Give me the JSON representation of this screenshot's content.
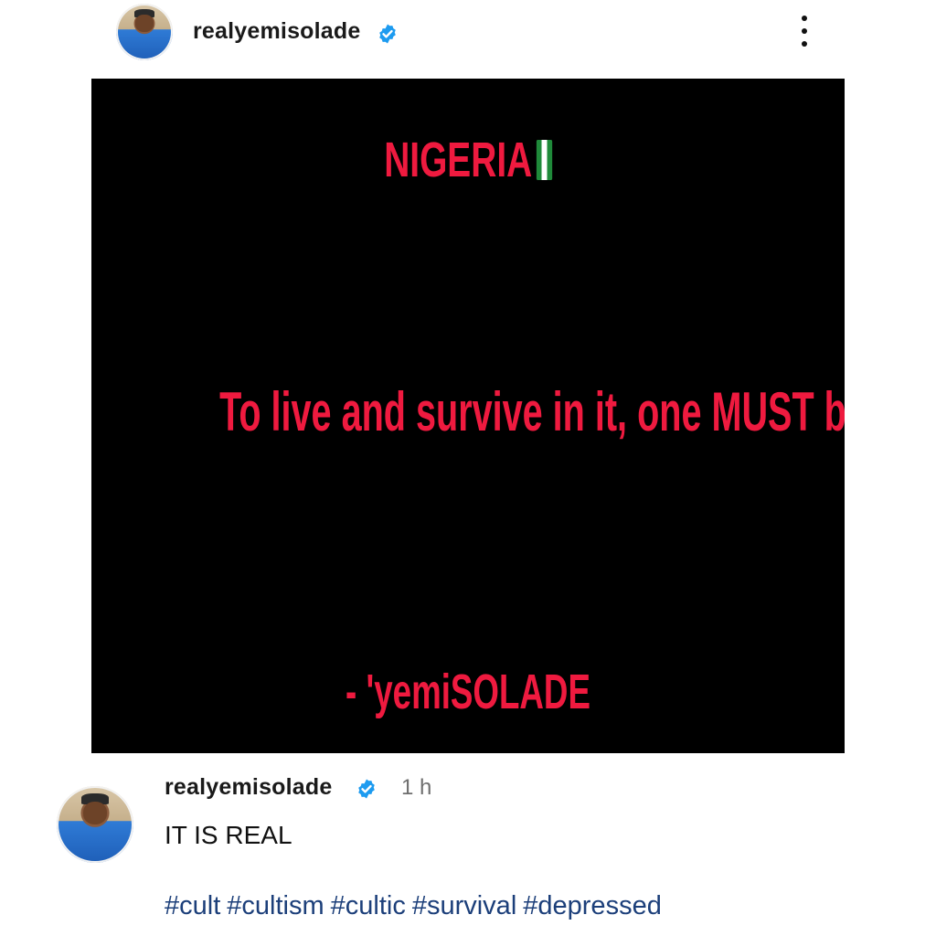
{
  "header": {
    "username": "realyemisolade",
    "avatar_icon": "profile-photo",
    "verified_icon": "verified-badge-icon",
    "more_icon": "more-options-icon"
  },
  "post_image": {
    "line1": "NIGERIA",
    "flag_icon": "nigeria-flag-icon",
    "line2": "To live and survive in it, one MUST belong to the CULT",
    "line3": "- 'yemiSOLADE",
    "text_color": "#ef1a3f",
    "background_color": "#000000"
  },
  "caption": {
    "username": "realyemisolade",
    "time": "1 h",
    "text": "IT IS REAL",
    "hashtags": [
      "#cult",
      "#cultism",
      "#cultic",
      "#survival",
      "#depressed"
    ],
    "hashtag_color": "#1c3f7a"
  },
  "colors": {
    "verified": "#1d9bf0"
  }
}
